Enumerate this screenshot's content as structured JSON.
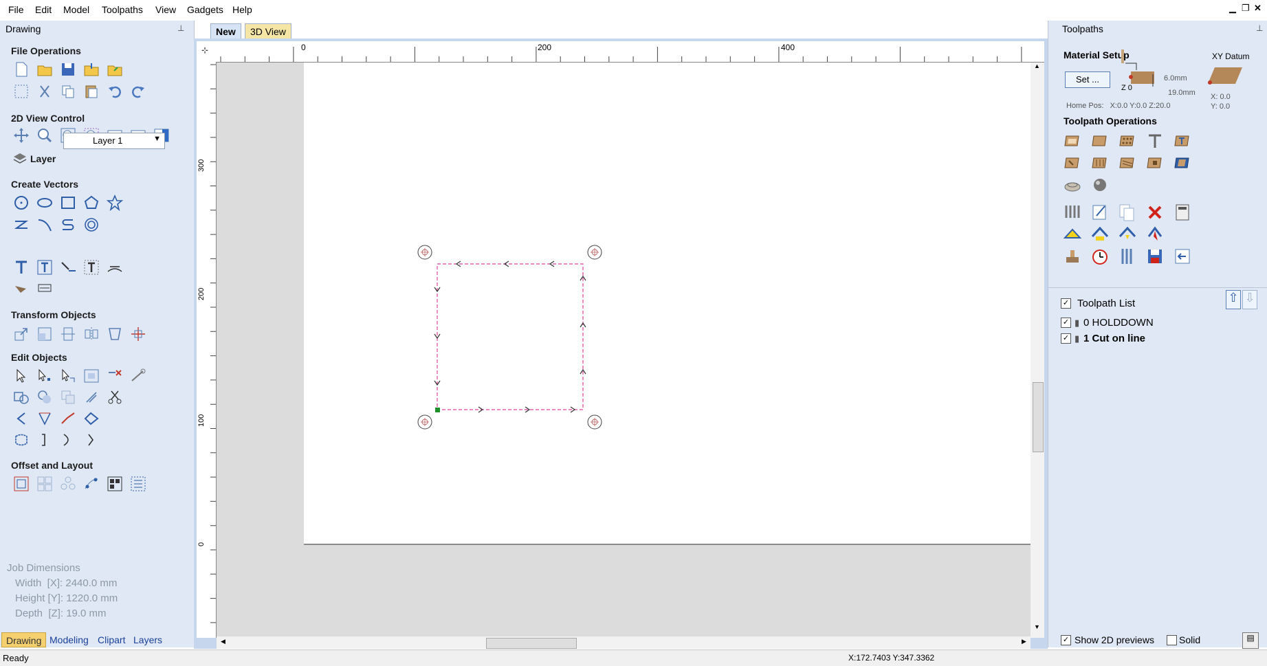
{
  "menu": [
    "File",
    "Edit",
    "Model",
    "Toolpaths",
    "View",
    "Gadgets",
    "Help"
  ],
  "left_panel": {
    "title": "Drawing",
    "sections": {
      "file_operations": "File Operations",
      "view_control": "2D View Control",
      "layer_label": "Layer",
      "layer_value": "Layer 1",
      "create_vectors": "Create Vectors",
      "transform_objects": "Transform Objects",
      "edit_objects": "Edit Objects",
      "offset_layout": "Offset and Layout"
    },
    "job_dimensions": {
      "title": "Job Dimensions",
      "width": "Width  [X]: 2440.0 mm",
      "height": "Height [Y]: 1220.0 mm",
      "depth": "Depth  [Z]: 19.0 mm"
    },
    "bottom_tabs": [
      "Drawing",
      "Modeling",
      "Clipart",
      "Layers"
    ]
  },
  "doc_tabs": [
    "New",
    "3D View"
  ],
  "rulers": {
    "top": [
      "0",
      "200",
      "400"
    ],
    "left": [
      "300",
      "200",
      "100",
      "0"
    ]
  },
  "right_panel": {
    "title": "Toolpaths",
    "material_setup": "Material Setup",
    "set_button": "Set ...",
    "z0": "Z 0",
    "dim_top": "6.0mm",
    "dim_bottom": "19.0mm",
    "xy_datum": "XY Datum",
    "datum_x": "X: 0.0",
    "datum_y": "Y: 0.0",
    "home_pos": "Home Pos:   X:0.0 Y:0.0 Z:20.0",
    "toolpath_operations": "Toolpath Operations",
    "toolpath_list_title": "Toolpath List",
    "toolpaths": [
      "0 HOLDDOWN",
      "1 Cut on line"
    ],
    "show_2d_previews": "Show 2D previews",
    "solid": "Solid"
  },
  "status": {
    "left": "Ready",
    "coords": "X:172.7403 Y:347.3362"
  },
  "colors": {
    "panel_bg": "#dfe8f4",
    "canvas_frame": "#c6d6ec",
    "vector_pink": "#e0409c",
    "tab_active": "#d6e4f6",
    "tab_3d": "#f6e6a6"
  }
}
